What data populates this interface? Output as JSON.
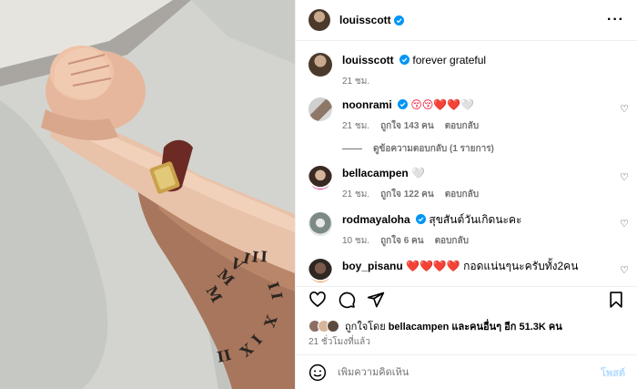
{
  "header": {
    "username": "louisscott",
    "more": "···"
  },
  "caption": {
    "username": "louisscott",
    "text": "forever grateful",
    "time": "21 ชม."
  },
  "comments": [
    {
      "username": "noonrami",
      "text": "😚😚❤️❤️🤍",
      "time": "21 ชม.",
      "likes": "ถูกใจ 143 คน",
      "reply": "ตอบกลับ",
      "view_replies": "ดูข้อความตอบกลับ (1 รายการ)"
    },
    {
      "username": "bellacampen",
      "text": "🤍",
      "time": "21 ชม.",
      "likes": "ถูกใจ 122 คน",
      "reply": "ตอบกลับ"
    },
    {
      "username": "rodmayaloha",
      "text": "สุขสันต์วันเกิดนะคะ",
      "time": "10 ชม.",
      "likes": "ถูกใจ 6 คน",
      "reply": "ตอบกลับ"
    },
    {
      "username": "boy_pisanu",
      "text": "❤️❤️❤️❤️ กอดแน่นๆนะครับทั้ง2คน"
    }
  ],
  "liked_by": {
    "prefix": "ถูกใจโดย",
    "user": "bellacampen",
    "middle": "และคนอื่นๆ อีก",
    "count": "51.3K คน"
  },
  "posted_ago": "21 ชั่วโมงที่แล้ว",
  "compose": {
    "placeholder": "เพิ่มความคิดเห็น",
    "post_label": "โพสต์"
  },
  "photo": {
    "tattoo": "XI · IX · MMVIII · II"
  },
  "colors": {
    "accent": "#0095f6",
    "verified": "#0095f6",
    "heart": "#ed1c3a",
    "post_disabled": "#b3dbff"
  }
}
